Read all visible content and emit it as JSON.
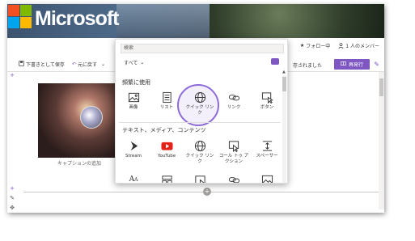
{
  "header": {
    "logo_text": "Microsoft",
    "follow_label": "フォロー中",
    "members_label": "1 人のメンバー"
  },
  "commandbar": {
    "save_draft": "下書きとして保存",
    "undo": "元に戻す",
    "saved_status": "存されました",
    "publish": "再発行"
  },
  "canvas": {
    "caption": "キャプションの追加"
  },
  "toolbox": {
    "search_placeholder": "検索",
    "filter_label": "すべて",
    "section_frequent": "頻繁に使用",
    "section_text_media": "テキスト、メディア、コンテンツ",
    "frequent": [
      {
        "label": "画像",
        "icon": "image-icon"
      },
      {
        "label": "リスト",
        "icon": "list-icon"
      },
      {
        "label": "クイック リンク",
        "icon": "globe-icon"
      },
      {
        "label": "リンク",
        "icon": "link-icon"
      },
      {
        "label": "ボタン",
        "icon": "button-icon"
      }
    ],
    "text_media": [
      {
        "label": "Stream",
        "icon": "stream-icon"
      },
      {
        "label": "YouTube",
        "icon": "youtube-icon"
      },
      {
        "label": "クイック リンク",
        "icon": "globe-icon"
      },
      {
        "label": "コール トゥ アクション",
        "icon": "call-to-action-icon"
      },
      {
        "label": "スペーサー",
        "icon": "spacer-icon"
      }
    ],
    "row3_icons": [
      "font-icon",
      "layout-icon",
      "image-embed-icon",
      "link-embed-icon",
      "image-gallery-icon"
    ]
  },
  "colors": {
    "accent": "#7e57c2",
    "highlight_ring": "#8e6ad8",
    "youtube_red": "#e62117"
  }
}
